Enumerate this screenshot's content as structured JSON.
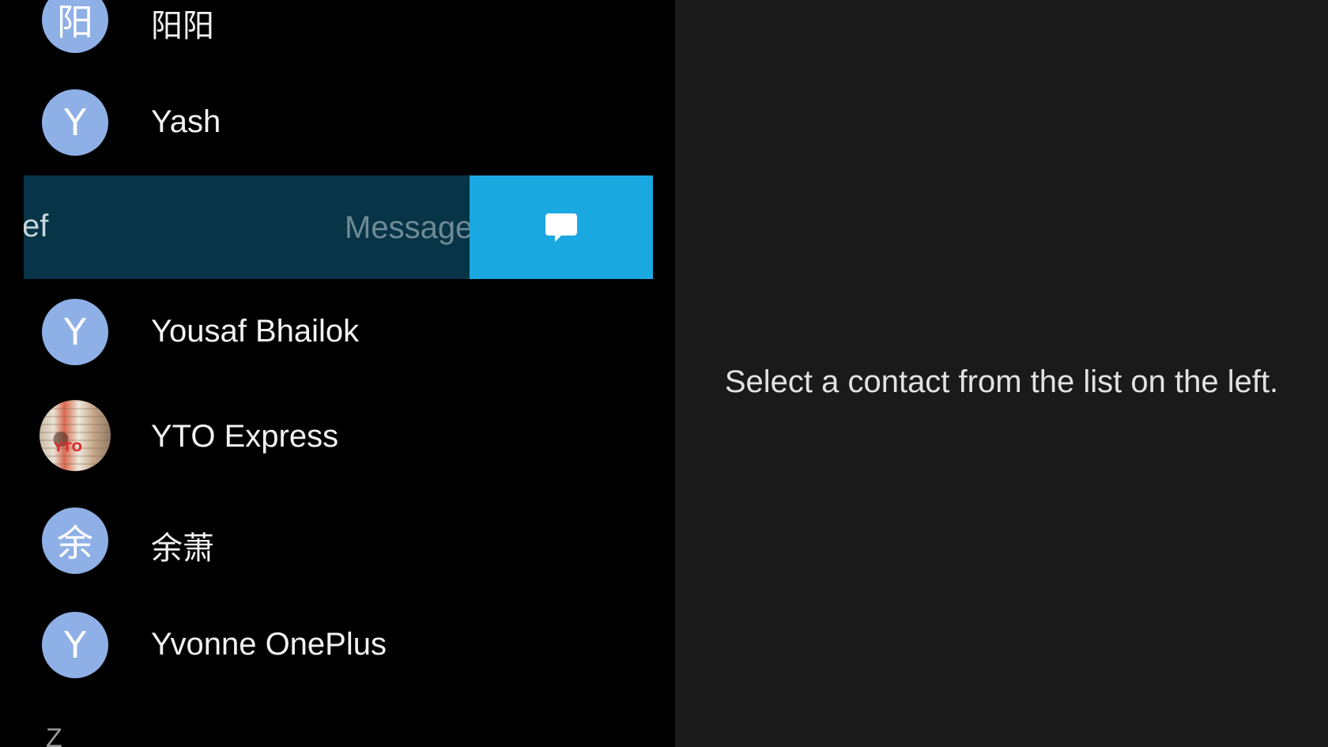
{
  "contacts_list": {
    "rows_before": [
      {
        "initial": "阳",
        "name": "阳阳"
      },
      {
        "initial": "Y",
        "name": "Yash"
      }
    ],
    "swiped_row": {
      "partial_name": "ef",
      "action_label": "Message",
      "action_icon": "message-bubble-icon"
    },
    "rows_after": [
      {
        "initial": "Y",
        "name": "Yousaf Bhailok"
      },
      {
        "initial": "",
        "name": "YTO Express",
        "photo_text": "YTO"
      },
      {
        "initial": "余",
        "name": "余萧"
      },
      {
        "initial": "Y",
        "name": "Yvonne OnePlus"
      }
    ],
    "next_section_letter": "Z"
  },
  "detail_pane": {
    "empty_message": "Select a contact from the list on the left."
  },
  "colors": {
    "avatar_bg": "#8fb0e6",
    "swipe_bg": "#073447",
    "swipe_action_bg": "#1aa8e0",
    "left_pane_bg": "#000000",
    "right_pane_bg": "#1a1a1a"
  }
}
